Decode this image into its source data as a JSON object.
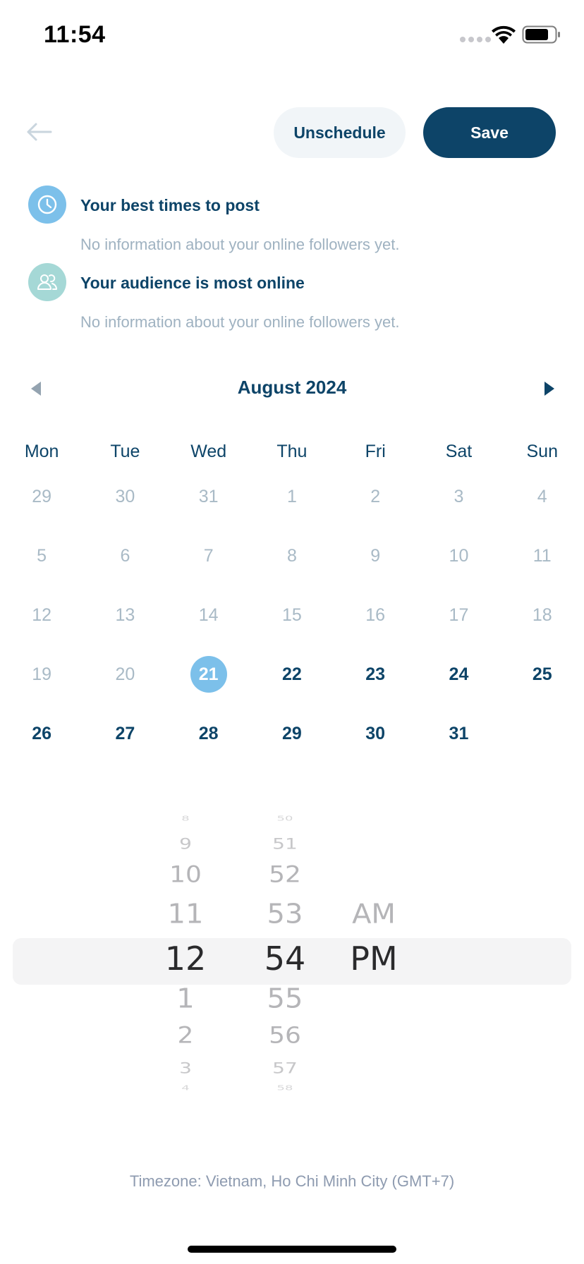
{
  "status": {
    "time": "11:54"
  },
  "header": {
    "unschedule_label": "Unschedule",
    "save_label": "Save"
  },
  "info": {
    "best_times_title": "Your best times to post",
    "best_times_sub": "No information about your online followers yet.",
    "audience_title": "Your audience is most online",
    "audience_sub": "No information about your online followers yet."
  },
  "calendar": {
    "month_label": "August 2024",
    "weekdays": [
      "Mon",
      "Tue",
      "Wed",
      "Thu",
      "Fri",
      "Sat",
      "Sun"
    ],
    "weeks": [
      [
        "29",
        "30",
        "31",
        "1",
        "2",
        "3",
        "4"
      ],
      [
        "5",
        "6",
        "7",
        "8",
        "9",
        "10",
        "11"
      ],
      [
        "12",
        "13",
        "14",
        "15",
        "16",
        "17",
        "18"
      ],
      [
        "19",
        "20",
        "21",
        "22",
        "23",
        "24",
        "25"
      ],
      [
        "26",
        "27",
        "28",
        "29",
        "30",
        "31",
        ""
      ]
    ],
    "selected_day": "21"
  },
  "time_picker": {
    "hours": [
      "8",
      "9",
      "10",
      "11",
      "12",
      "1",
      "2",
      "3",
      "4"
    ],
    "minutes": [
      "50",
      "51",
      "52",
      "53",
      "54",
      "55",
      "56",
      "57",
      "58"
    ],
    "ampm": [
      "AM",
      "PM"
    ],
    "selected_hour": "12",
    "selected_minute": "54",
    "selected_ampm": "PM"
  },
  "timezone_label": "Timezone: Vietnam, Ho Chi Minh City (GMT+7)",
  "colors": {
    "primary": "#0d4468",
    "accent_blue": "#7cc0ea",
    "accent_teal": "#a5d8d6",
    "muted_text": "#9fb2c1"
  },
  "icons": {
    "back": "arrow-left-icon",
    "best_times": "clock-icon",
    "audience": "people-icon",
    "prev_month": "triangle-left-icon",
    "next_month": "triangle-right-icon"
  }
}
